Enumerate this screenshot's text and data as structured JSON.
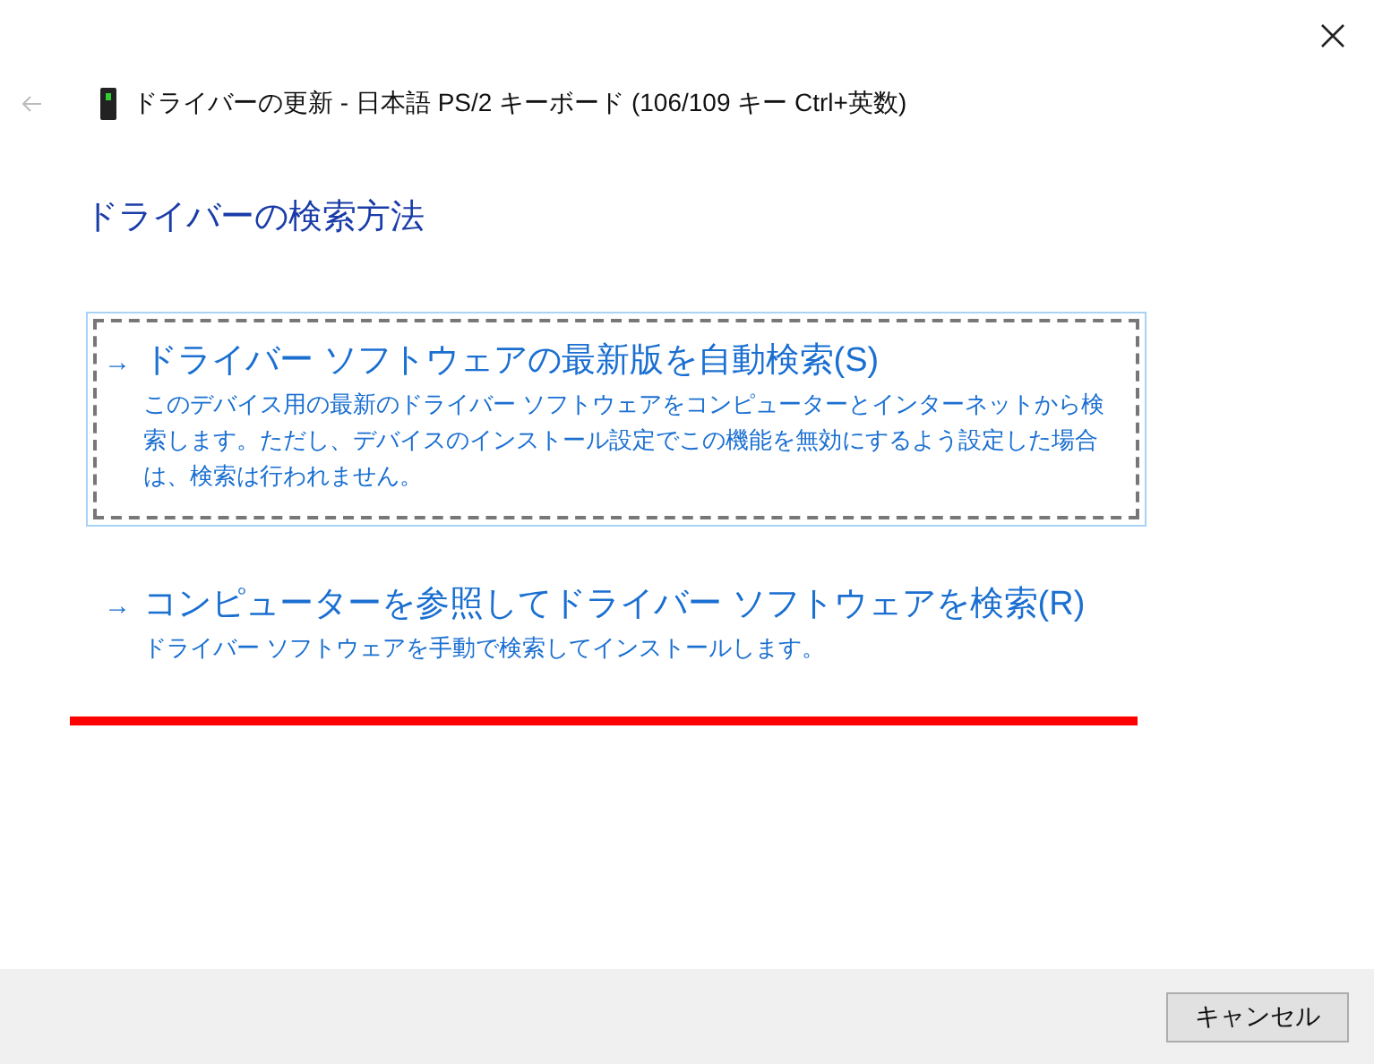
{
  "window": {
    "title": "ドライバーの更新 - 日本語 PS/2 キーボード (106/109 キー Ctrl+英数)"
  },
  "heading": "ドライバーの検索方法",
  "options": [
    {
      "arrow": "→",
      "title": "ドライバー ソフトウェアの最新版を自動検索(S)",
      "description": "このデバイス用の最新のドライバー ソフトウェアをコンピューターとインターネットから検索します。ただし、デバイスのインストール設定でこの機能を無効にするよう設定した場合は、検索は行われません。",
      "selected": true
    },
    {
      "arrow": "→",
      "title": "コンピューターを参照してドライバー ソフトウェアを検索(R)",
      "description": "ドライバー ソフトウェアを手動で検索してインストールします。",
      "selected": false
    }
  ],
  "buttons": [
    "キャンセル"
  ]
}
